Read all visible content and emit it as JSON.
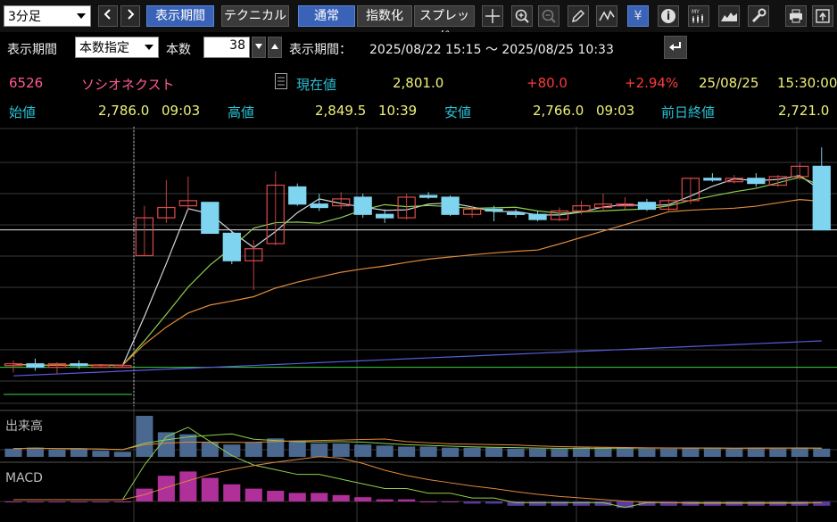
{
  "toolbar": {
    "interval": "3分足",
    "period_button": "表示期間",
    "technical_button": "テクニカル",
    "normal_button": "通常",
    "index_button": "指数化",
    "spread_button": "スプレッド",
    "icons": [
      "crosshair-icon",
      "zoom-in-icon",
      "zoom-out-icon",
      "pencil-icon",
      "trend-icon",
      "yen-icon",
      "info-icon",
      "my-indicator-icon",
      "mountain-chart-icon",
      "wrench-icon",
      "print-icon",
      "export-icon"
    ],
    "yen_glyph": "¥",
    "info_glyph": "i",
    "my_glyph": "MY"
  },
  "period_bar": {
    "label": "表示期間",
    "mode": "本数指定",
    "count_label": "本数",
    "count": "38",
    "range_label": "表示期間：",
    "range": "2025/08/22 15:15 ～ 2025/08/25 10:33"
  },
  "quote": {
    "code": "6526",
    "name": "ソシオネクスト",
    "current_label": "現在値",
    "current": "2,801.0",
    "change": "+80.0",
    "change_pct": "+2.94%",
    "date": "25/08/25",
    "time": "15:30:00",
    "open_label": "始値",
    "open": "2,786.0",
    "open_time": "09:03",
    "high_label": "高値",
    "high": "2,849.5",
    "high_time": "10:39",
    "low_label": "安値",
    "low": "2,766.0",
    "low_time": "09:03",
    "prev_label": "前日終値",
    "prev": "2,721.0"
  },
  "panels": {
    "volume_label": "出来高",
    "macd_label": "MACD"
  },
  "colors": {
    "up": "#e04a4a",
    "down": "#7fd4f0",
    "ma_short": "#8ed04e",
    "ma_mid": "#e08a3a",
    "ma_long": "#5a5ae0",
    "ma_white": "#d0d8e0",
    "volume_bar": "#4a6890",
    "macd_pos": "#b0309a",
    "macd_neg": "#5a3aa0"
  },
  "chart_data": {
    "type": "candlestick",
    "ylim": [
      2700,
      2860
    ],
    "candles": [
      {
        "o": 2722,
        "h": 2725,
        "l": 2718,
        "c": 2723
      },
      {
        "o": 2723,
        "h": 2726,
        "l": 2719,
        "c": 2721
      },
      {
        "o": 2721,
        "h": 2724,
        "l": 2717,
        "c": 2723
      },
      {
        "o": 2723,
        "h": 2725,
        "l": 2720,
        "c": 2722
      },
      {
        "o": 2722,
        "h": 2723,
        "l": 2721,
        "c": 2722
      },
      {
        "o": 2722,
        "h": 2723,
        "l": 2721,
        "c": 2722
      },
      {
        "o": 2786,
        "h": 2815,
        "l": 2786,
        "c": 2808
      },
      {
        "o": 2808,
        "h": 2830,
        "l": 2805,
        "c": 2814
      },
      {
        "o": 2815,
        "h": 2832,
        "l": 2812,
        "c": 2818
      },
      {
        "o": 2817,
        "h": 2817,
        "l": 2799,
        "c": 2799
      },
      {
        "o": 2799,
        "h": 2800,
        "l": 2781,
        "c": 2783
      },
      {
        "o": 2783,
        "h": 2795,
        "l": 2766,
        "c": 2790
      },
      {
        "o": 2793,
        "h": 2835,
        "l": 2792,
        "c": 2827
      },
      {
        "o": 2826,
        "h": 2828,
        "l": 2815,
        "c": 2816
      },
      {
        "o": 2816,
        "h": 2822,
        "l": 2812,
        "c": 2814
      },
      {
        "o": 2815,
        "h": 2823,
        "l": 2813,
        "c": 2819
      },
      {
        "o": 2820,
        "h": 2822,
        "l": 2808,
        "c": 2810
      },
      {
        "o": 2810,
        "h": 2813,
        "l": 2805,
        "c": 2808
      },
      {
        "o": 2808,
        "h": 2822,
        "l": 2807,
        "c": 2820
      },
      {
        "o": 2821,
        "h": 2823,
        "l": 2819,
        "c": 2820
      },
      {
        "o": 2820,
        "h": 2821,
        "l": 2809,
        "c": 2810
      },
      {
        "o": 2810,
        "h": 2815,
        "l": 2808,
        "c": 2813
      },
      {
        "o": 2813,
        "h": 2815,
        "l": 2806,
        "c": 2812
      },
      {
        "o": 2811,
        "h": 2813,
        "l": 2808,
        "c": 2810
      },
      {
        "o": 2810,
        "h": 2812,
        "l": 2806,
        "c": 2807
      },
      {
        "o": 2807,
        "h": 2814,
        "l": 2806,
        "c": 2812
      },
      {
        "o": 2812,
        "h": 2818,
        "l": 2810,
        "c": 2815
      },
      {
        "o": 2814,
        "h": 2822,
        "l": 2812,
        "c": 2816
      },
      {
        "o": 2815,
        "h": 2820,
        "l": 2813,
        "c": 2816
      },
      {
        "o": 2817,
        "h": 2819,
        "l": 2812,
        "c": 2813
      },
      {
        "o": 2813,
        "h": 2819,
        "l": 2812,
        "c": 2818
      },
      {
        "o": 2818,
        "h": 2831,
        "l": 2816,
        "c": 2831
      },
      {
        "o": 2831,
        "h": 2834,
        "l": 2829,
        "c": 2830
      },
      {
        "o": 2829,
        "h": 2833,
        "l": 2828,
        "c": 2831
      },
      {
        "o": 2831,
        "h": 2834,
        "l": 2826,
        "c": 2828
      },
      {
        "o": 2827,
        "h": 2833,
        "l": 2826,
        "c": 2832
      },
      {
        "o": 2832,
        "h": 2840,
        "l": 2830,
        "c": 2838
      },
      {
        "o": 2838,
        "h": 2849,
        "l": 2835,
        "c": 2801
      }
    ],
    "volume": [
      8,
      9,
      7,
      8,
      6,
      5,
      40,
      24,
      22,
      14,
      12,
      14,
      18,
      16,
      13,
      13,
      12,
      11,
      10,
      10,
      9,
      9,
      9,
      8,
      8,
      8,
      9,
      9,
      9,
      8,
      8,
      9,
      9,
      8,
      9,
      8,
      9,
      8
    ],
    "macd": [
      0,
      0,
      0,
      0,
      0,
      0,
      6,
      12,
      14,
      11,
      8,
      6,
      5,
      4,
      4,
      3,
      2,
      1,
      1,
      0,
      0,
      -1,
      -1,
      -2,
      -2,
      -2,
      -2,
      -2,
      -3,
      -2,
      -2,
      -2,
      -2,
      -2,
      -2,
      -2,
      -2,
      -2
    ]
  }
}
